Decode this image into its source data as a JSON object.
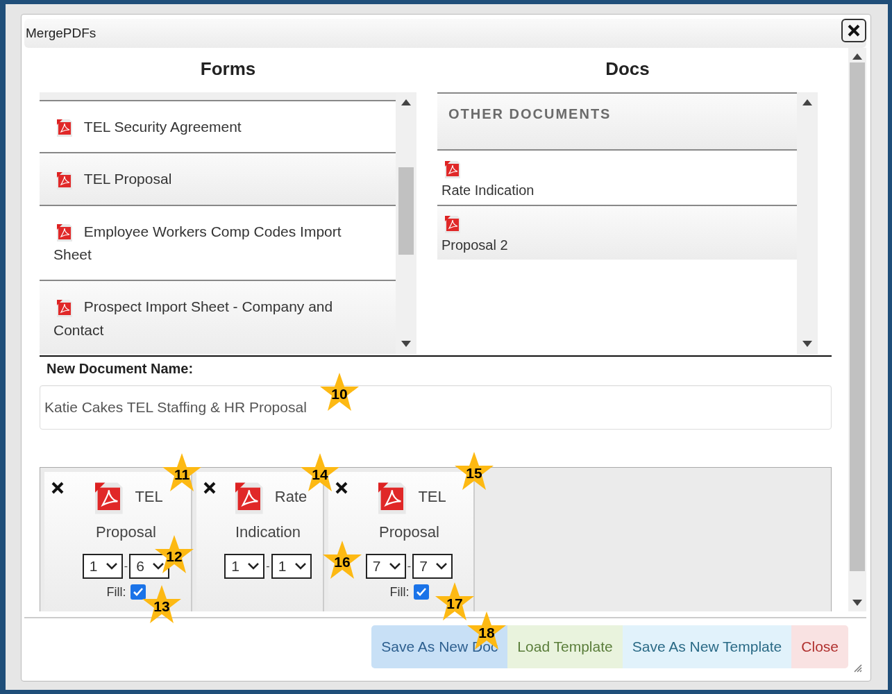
{
  "window": {
    "title": "MergePDFs"
  },
  "forms": {
    "heading": "Forms",
    "items": [
      {
        "label": "TEL Security Agreement"
      },
      {
        "label": "TEL Proposal"
      },
      {
        "label": "Employee Workers Comp Codes Import Sheet"
      },
      {
        "label": "Prospect Import Sheet - Company and Contact"
      }
    ]
  },
  "docs": {
    "heading": "Docs",
    "group": "OTHER DOCUMENTS",
    "items": [
      {
        "label": "Rate Indication"
      },
      {
        "label": "Proposal 2"
      }
    ]
  },
  "new_document_name": {
    "label": "New Document Name:",
    "value": "Katie Cakes TEL Staffing & HR Proposal"
  },
  "selected_docs": [
    {
      "title": "TEL Proposal",
      "from": "1",
      "separator": "-",
      "to": "6",
      "fill_label": "Fill:",
      "fill": true
    },
    {
      "title": "Rate Indication",
      "from": "1",
      "separator": "-",
      "to": "1"
    },
    {
      "title": "TEL Proposal",
      "from": "7",
      "separator": "-",
      "to": "7",
      "fill_label": "Fill:",
      "fill": true
    }
  ],
  "buttons": [
    {
      "label": "Save As New Doc",
      "kind": "primary"
    },
    {
      "label": "Load Template",
      "kind": "success"
    },
    {
      "label": "Save As New Template",
      "kind": "info"
    },
    {
      "label": "Close",
      "kind": "danger"
    }
  ],
  "callouts": [
    {
      "label": "10"
    },
    {
      "label": "11"
    },
    {
      "label": "12"
    },
    {
      "label": "13"
    },
    {
      "label": "14"
    },
    {
      "label": "15"
    },
    {
      "label": "16"
    },
    {
      "label": "17"
    },
    {
      "label": "18"
    }
  ]
}
